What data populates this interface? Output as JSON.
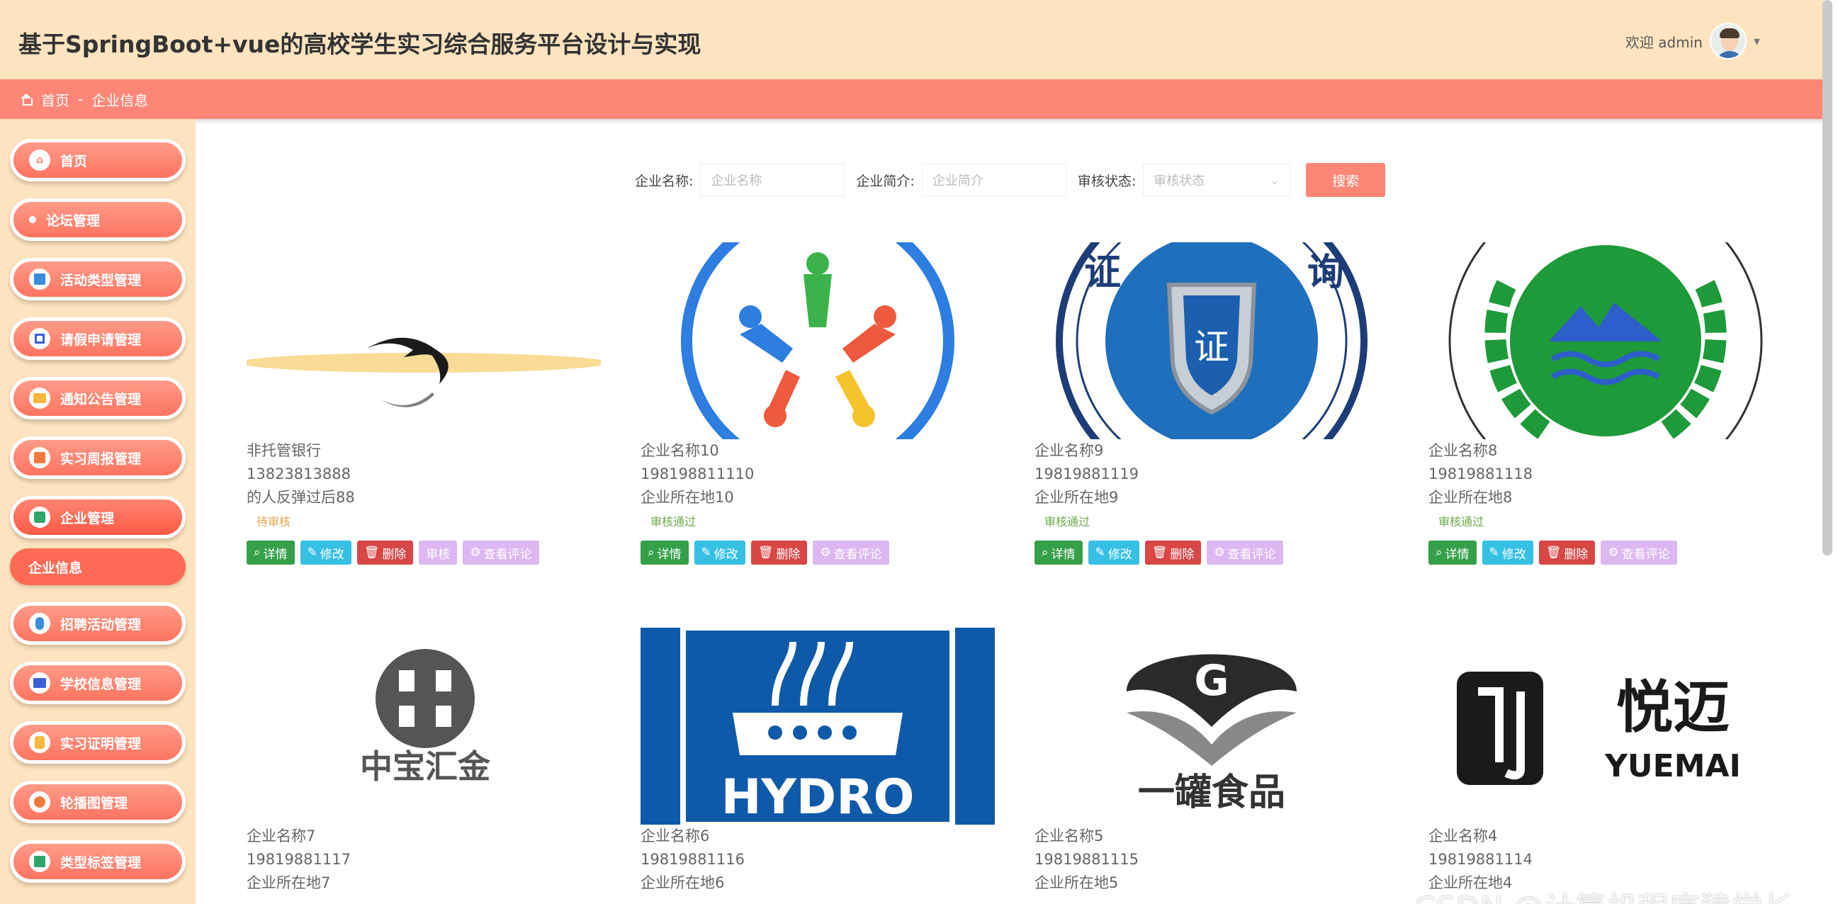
{
  "header": {
    "title": "基于SpringBoot+vue的高校学生实习综合服务平台设计与实现",
    "welcome": "欢迎 admin",
    "chevron": "▾"
  },
  "breadcrumb": {
    "home": "首页",
    "separator": "-",
    "current": "企业信息"
  },
  "sidebar": {
    "items": [
      {
        "label": "首页"
      },
      {
        "label": "论坛管理"
      },
      {
        "label": "活动类型管理"
      },
      {
        "label": "请假申请管理"
      },
      {
        "label": "通知公告管理"
      },
      {
        "label": "实习周报管理"
      },
      {
        "label": "企业管理"
      },
      {
        "label": "企业信息"
      },
      {
        "label": "招聘活动管理"
      },
      {
        "label": "学校信息管理"
      },
      {
        "label": "实习证明管理"
      },
      {
        "label": "轮播图管理"
      },
      {
        "label": "类型标签管理"
      }
    ]
  },
  "search": {
    "name_label": "企业名称:",
    "name_placeholder": "企业名称",
    "intro_label": "企业简介:",
    "intro_placeholder": "企业简介",
    "status_label": "审核状态:",
    "status_placeholder": "审核状态",
    "button": "搜索"
  },
  "actions": {
    "detail": "详情",
    "edit": "修改",
    "delete": "删除",
    "audit": "审核",
    "comment": "查看评论"
  },
  "cards": [
    {
      "name": "非托管银行",
      "phone": "13823813888",
      "address": "的人反弹过后88",
      "status": "待审核"
    },
    {
      "name": "企业名称10",
      "phone": "198198811110",
      "address": "企业所在地10",
      "status": "审核通过"
    },
    {
      "name": "企业名称9",
      "phone": "19819881119",
      "address": "企业所在地9",
      "status": "审核通过"
    },
    {
      "name": "企业名称8",
      "phone": "19819881118",
      "address": "企业所在地8",
      "status": "审核通过"
    },
    {
      "name": "企业名称7",
      "phone": "19819881117",
      "address": "企业所在地7"
    },
    {
      "name": "企业名称6",
      "phone": "19819881116",
      "address": "企业所在地6"
    },
    {
      "name": "企业名称5",
      "phone": "19819881115",
      "address": "企业所在地5"
    },
    {
      "name": "企业名称4",
      "phone": "19819881114",
      "address": "企业所在地4"
    }
  ],
  "logos": {
    "zhongbao": "中宝汇金",
    "hydro": "HYDRO",
    "yiguan": "一罐食品",
    "yuemai_cn": "悦迈",
    "yuemai_en": "YUEMAI",
    "g_letter": "G",
    "zheng": "证",
    "zheng_left": "证",
    "zheng_right": "询"
  },
  "watermark": "CSDN @计算机程序猿学长",
  "colors": {
    "header_bg": "#fde3bf",
    "accent": "#fe8677",
    "detail": "#35a04a",
    "edit": "#36c0e4",
    "delete": "#d84646",
    "comment": "#dcb7f1"
  }
}
